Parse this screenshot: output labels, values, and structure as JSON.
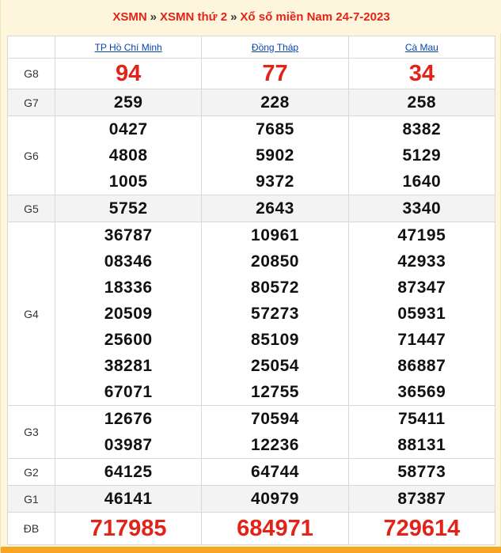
{
  "header": {
    "link1": "XSMN",
    "sep1": "»",
    "link2": "XSMN thứ 2",
    "sep2": "»",
    "link3": "Xổ số miền Nam 24-7-2023"
  },
  "provinces": [
    "TP Hồ Chí Minh",
    "Đồng Tháp",
    "Cà Mau"
  ],
  "prizes": [
    {
      "label": "G8",
      "results": [
        [
          "94"
        ],
        [
          "77"
        ],
        [
          "34"
        ]
      ]
    },
    {
      "label": "G7",
      "results": [
        [
          "259"
        ],
        [
          "228"
        ],
        [
          "258"
        ]
      ]
    },
    {
      "label": "G6",
      "results": [
        [
          "0427",
          "4808",
          "1005"
        ],
        [
          "7685",
          "5902",
          "9372"
        ],
        [
          "8382",
          "5129",
          "1640"
        ]
      ]
    },
    {
      "label": "G5",
      "results": [
        [
          "5752"
        ],
        [
          "2643"
        ],
        [
          "3340"
        ]
      ]
    },
    {
      "label": "G4",
      "results": [
        [
          "36787",
          "08346",
          "18336",
          "20509",
          "25600",
          "38281",
          "67071"
        ],
        [
          "10961",
          "20850",
          "80572",
          "57273",
          "85109",
          "25054",
          "12755"
        ],
        [
          "47195",
          "42933",
          "87347",
          "05931",
          "71447",
          "86887",
          "36569"
        ]
      ]
    },
    {
      "label": "G3",
      "results": [
        [
          "12676",
          "03987"
        ],
        [
          "70594",
          "12236"
        ],
        [
          "75411",
          "88131"
        ]
      ]
    },
    {
      "label": "G2",
      "results": [
        [
          "64125"
        ],
        [
          "64744"
        ],
        [
          "58773"
        ]
      ]
    },
    {
      "label": "G1",
      "results": [
        [
          "46141"
        ],
        [
          "40979"
        ],
        [
          "87387"
        ]
      ]
    },
    {
      "label": "ĐB",
      "results": [
        [
          "717985"
        ],
        [
          "684971"
        ],
        [
          "729614"
        ]
      ]
    }
  ]
}
